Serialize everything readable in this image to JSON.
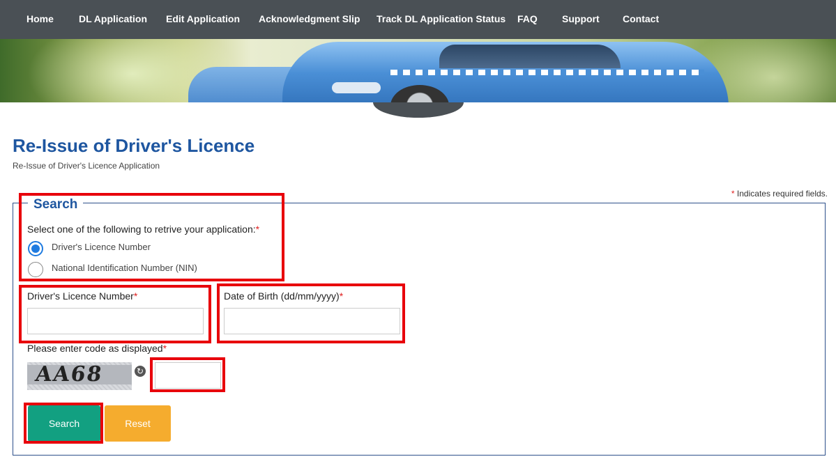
{
  "nav": {
    "items": [
      {
        "label": "Home"
      },
      {
        "label": "DL Application"
      },
      {
        "label": "Edit Application"
      },
      {
        "label": "Acknowledgment Slip"
      },
      {
        "label": "Track DL Application Status"
      },
      {
        "label": "FAQ"
      },
      {
        "label": "Support"
      },
      {
        "label": "Contact"
      }
    ]
  },
  "page": {
    "title": "Re-Issue of Driver's Licence",
    "subtitle": "Re-Issue of Driver's Licence Application",
    "required_note": "Indicates required fields.",
    "required_star": "*"
  },
  "search": {
    "legend": "Search",
    "select_prompt": "Select one of the following to retrive your application:",
    "options": [
      {
        "label": "Driver's Licence Number",
        "checked": true
      },
      {
        "label": "National Identification Number (NIN)",
        "checked": false
      }
    ],
    "licence_label": "Driver's Licence Number",
    "licence_value": "",
    "dob_label": "Date of Birth (dd/mm/yyyy)",
    "dob_value": "",
    "captcha_label": "Please enter code as displayed",
    "captcha_text": "AA68",
    "captcha_value": "",
    "search_button": "Search",
    "reset_button": "Reset"
  },
  "colors": {
    "nav_bg": "#4a5055",
    "title": "#1e56a0",
    "search_button": "#12a081",
    "reset_button": "#f5ac2e",
    "highlight": "#e8000b",
    "radio_selected": "#1f7be0"
  }
}
